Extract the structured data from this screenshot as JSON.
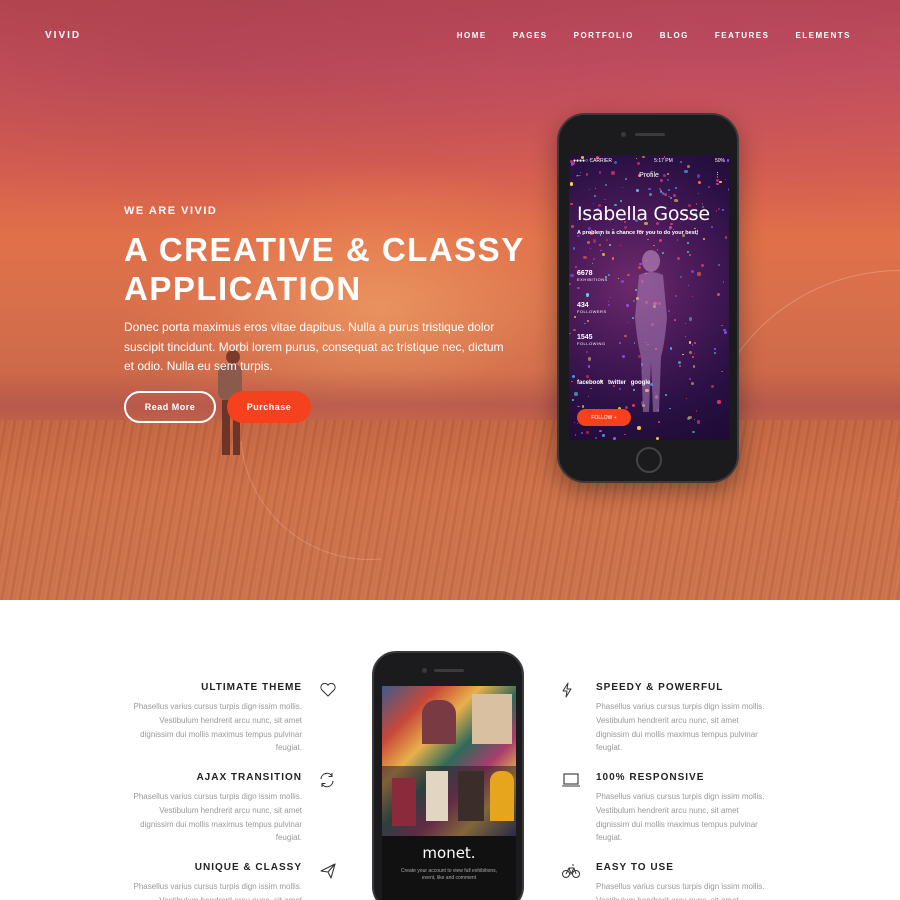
{
  "brand": "VIVID",
  "nav": [
    "HOME",
    "PAGES",
    "PORTFOLIO",
    "BLOG",
    "FEATURES",
    "ELEMENTS"
  ],
  "hero": {
    "eyebrow": "WE ARE VIVID",
    "headline": "A CREATIVE & CLASSY APPLICATION",
    "lead": "Donec porta maximus eros vitae dapibus. Nulla a purus tristique dolor suscipit tincidunt. Morbi lorem purus, consequat ac tristique nec, dictum et odio. Nulla eu sem turpis.",
    "btn_read_more": "Read More",
    "btn_purchase": "Purchase"
  },
  "phone_profile": {
    "status_carrier": "●●●●○ CARRIER",
    "status_time": "5:17 PM",
    "status_battery": "50%",
    "title": "Profile",
    "name": "Isabella Gosse",
    "tagline": "A problem is a chance for you to do your best!",
    "stats": [
      {
        "value": "6678",
        "label": "EXHIBITIONS"
      },
      {
        "value": "434",
        "label": "FOLLOWERS"
      },
      {
        "value": "1545",
        "label": "FOLLOWING"
      }
    ],
    "social": [
      "facebook",
      "twitter",
      "google"
    ],
    "follow": "FOLLOW +"
  },
  "features": {
    "left": [
      {
        "title": "ULTIMATE THEME",
        "text": "Phasellus varius cursus turpis dign issim mollis. Vestibulum hendrerit arcu nunc, sit amet dignissim dui mollis maximus tempus pulvinar feugiat.",
        "icon": "heart-icon"
      },
      {
        "title": "AJAX TRANSITION",
        "text": "Phasellus varius cursus turpis dign issim mollis. Vestibulum hendrerit arcu nunc, sit amet dignissim dui mollis maximus tempus pulvinar feugiat.",
        "icon": "refresh-icon"
      },
      {
        "title": "UNIQUE & CLASSY",
        "text": "Phasellus varius cursus turpis dign issim mollis. Vestibulum hendrerit arcu nunc, sit amet dignissim dui mollis maximus tempus pulvinar feugiat.",
        "icon": "paper-plane-icon"
      }
    ],
    "right": [
      {
        "title": "SPEEDY & POWERFUL",
        "text": "Phasellus varius cursus turpis dign issim mollis. Vestibulum hendrerit arcu nunc, sit amet dignissim dui mollis maximus tempus pulvinar feugiat.",
        "icon": "lightning-icon"
      },
      {
        "title": "100% RESPONSIVE",
        "text": "Phasellus varius cursus turpis dign issim mollis. Vestibulum hendrerit arcu nunc, sit amet dignissim dui mollis maximus tempus pulvinar feugiat.",
        "icon": "laptop-icon"
      },
      {
        "title": "EASY TO USE",
        "text": "Phasellus varius cursus turpis dign issim mollis. Vestibulum hendrerit arcu nunc, sit amet dignissim dui mollis maximus tempus pulvinar feugiat.",
        "icon": "bicycle-icon"
      }
    ]
  },
  "phone_app": {
    "brand": "monet.",
    "sub": "Create your account to view full exhibitions, event, like and comment"
  },
  "colors": {
    "accent": "#f5411e",
    "hero_top": "#b8484f",
    "hero_mid": "#e0704a"
  }
}
